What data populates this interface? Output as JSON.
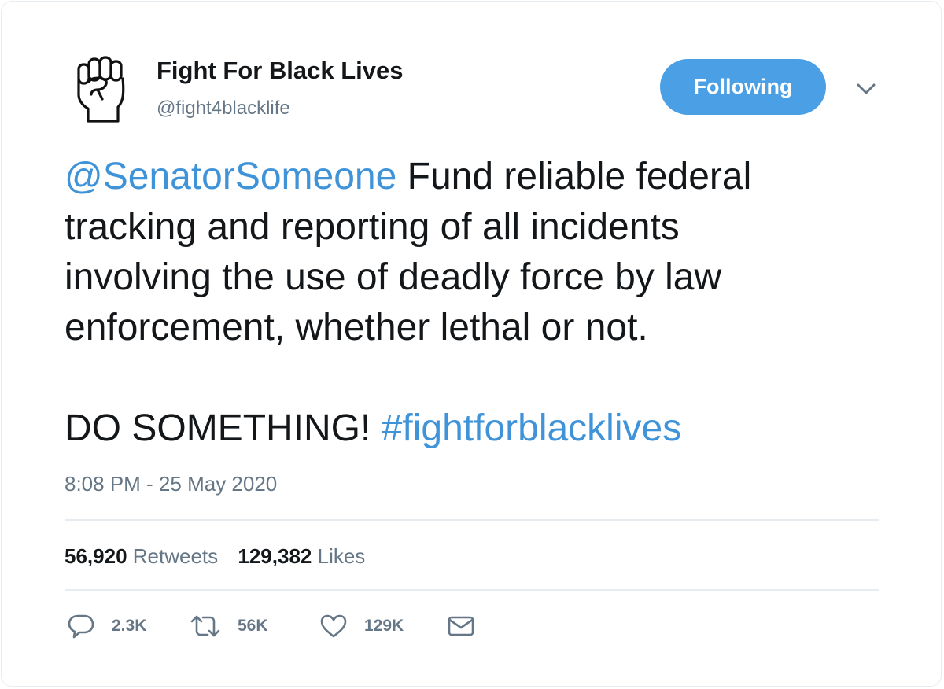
{
  "user": {
    "display_name": "Fight For Black Lives",
    "handle": "@fight4blacklife",
    "avatar_icon": "raised-fist-icon"
  },
  "follow_button": {
    "label": "Following",
    "color": "#4a9fe5"
  },
  "tweet": {
    "mention": "@SenatorSomeone",
    "line1_rest": " Fund reliable federal",
    "line2": "tracking and reporting of all incidents",
    "line3": "involving the use of deadly force by law",
    "line4": "enforcement, whether lethal or not.",
    "cta": "DO SOMETHING! ",
    "hashtag": "#fightforblacklives",
    "link_color": "#3f93d9"
  },
  "timestamp": "8:08 PM - 25 May 2020",
  "stats": {
    "retweets_count": "56,920",
    "retweets_label": "Retweets",
    "likes_count": "129,382",
    "likes_label": "Likes"
  },
  "actions": {
    "reply_icon": "reply-bubble-icon",
    "reply_count": "2.3K",
    "retweet_icon": "retweet-icon",
    "retweet_count": "56K",
    "like_icon": "heart-icon",
    "like_count": "129K",
    "dm_icon": "envelope-icon"
  }
}
